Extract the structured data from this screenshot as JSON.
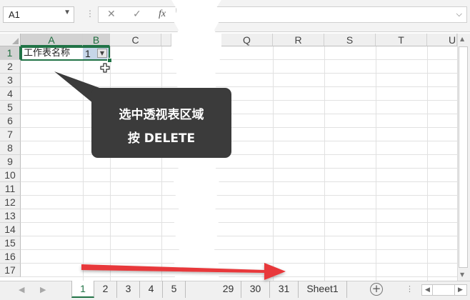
{
  "name_box": {
    "value": "A1"
  },
  "formula_bar": {
    "separator": "⋮",
    "cancel": "✕",
    "enter": "✓",
    "fx": "fx",
    "value": ""
  },
  "columns_left": [
    "A",
    "B",
    "C"
  ],
  "columns_right": [
    "Q",
    "R",
    "S",
    "T",
    "U"
  ],
  "rows": [
    "1",
    "2",
    "3",
    "4",
    "5",
    "6",
    "7",
    "8",
    "9",
    "10",
    "11",
    "12",
    "13",
    "14",
    "15",
    "16",
    "17"
  ],
  "cells": {
    "A1": "工作表名称",
    "B1": "1"
  },
  "tooltip": {
    "line1": "选中透视表区域",
    "line2": "按 DELETE"
  },
  "sheet_tabs_left": [
    "1",
    "2",
    "3",
    "4",
    "5"
  ],
  "sheet_tabs_right": [
    "29",
    "30",
    "31",
    "Sheet1"
  ],
  "active_sheet": "1",
  "icons": {
    "add_sheet": "plus-circle-icon",
    "filter": "filter-dropdown-icon",
    "cursor": "plus-cursor-icon"
  },
  "colors": {
    "excel_green": "#217346",
    "tooltip_bg": "#3b3b3b",
    "arrow_red": "#e8383b"
  }
}
